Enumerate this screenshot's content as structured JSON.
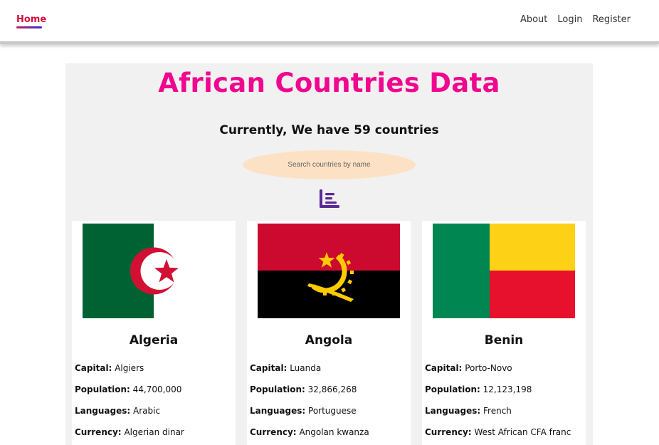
{
  "nav": {
    "home": "Home",
    "links": [
      "About",
      "Login",
      "Register"
    ]
  },
  "main": {
    "title": "African Countries Data",
    "count_text": "Currently, We have 59 countries",
    "search_placeholder": "Search countries by name"
  },
  "labels": {
    "capital": "Capital:",
    "population": "Population:",
    "languages": "Languages:",
    "currency": "Currency:"
  },
  "countries": [
    {
      "name": "Algeria",
      "capital": "Algiers",
      "population": "44,700,000",
      "languages": "Arabic",
      "currency": "Algerian dinar"
    },
    {
      "name": "Angola",
      "capital": "Luanda",
      "population": "32,866,268",
      "languages": "Portuguese",
      "currency": "Angolan kwanza"
    },
    {
      "name": "Benin",
      "capital": "Porto-Novo",
      "population": "12,123,198",
      "languages": "French",
      "currency": "West African CFA franc"
    }
  ],
  "icons": {
    "stats": "bar-chart-icon"
  },
  "colors": {
    "title": "#f0068f",
    "home_link": "#d4103c",
    "home_underline_start": "#c0205a",
    "home_underline_end": "#3b2fd8",
    "search_bg": "#fde1c4",
    "icon": "#5b2a9a",
    "panel_bg": "#f1f1f1"
  }
}
